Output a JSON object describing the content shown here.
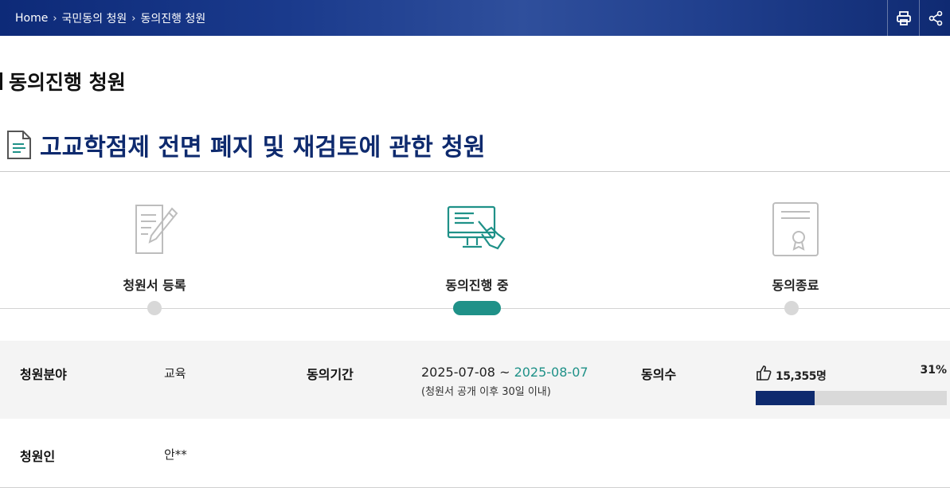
{
  "breadcrumb": {
    "home": "Home",
    "level1": "국민동의 청원",
    "level2": "동의진행 청원"
  },
  "header_icons": {
    "print": "print-icon",
    "share": "share-icon"
  },
  "page_title": "동의진행 청원",
  "petition_title": "고교학점제 전면 폐지 및 재검토에 관한 청원",
  "steps": [
    {
      "label": "청원서 등록",
      "icon": "document-pen-icon",
      "active": false
    },
    {
      "label": "동의진행 중",
      "icon": "monitor-hand-icon",
      "active": true
    },
    {
      "label": "동의종료",
      "icon": "certificate-icon",
      "active": false
    }
  ],
  "info": {
    "field_label": "청원분야",
    "field_value": "교육",
    "period_label": "동의기간",
    "period_start": "2025-07-08 ~ ",
    "period_end": "2025-08-07",
    "period_note": "(청원서 공개 이후 30일 이내)",
    "count_label": "동의수",
    "count_value": "15,355명",
    "percent_label": "31%",
    "percent": 31,
    "petitioner_label": "청원인",
    "petitioner_value": "안**"
  },
  "colors": {
    "navy": "#0e2a6e",
    "teal": "#1f9188"
  }
}
